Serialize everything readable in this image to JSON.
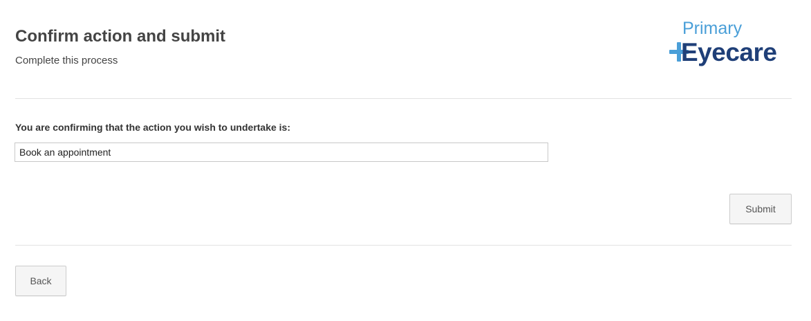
{
  "header": {
    "title": "Confirm action and submit",
    "subtitle": "Complete this process"
  },
  "logo": {
    "line1": "Primary",
    "line2": "Eyecare",
    "icon": "plus-icon",
    "colors": {
      "light_blue": "#4a9fd8",
      "dark_blue": "#1f3f78"
    }
  },
  "form": {
    "label": "You are confirming that the action you wish to undertake is:",
    "action_value": "Book an appointment"
  },
  "buttons": {
    "submit_label": "Submit",
    "back_label": "Back"
  }
}
